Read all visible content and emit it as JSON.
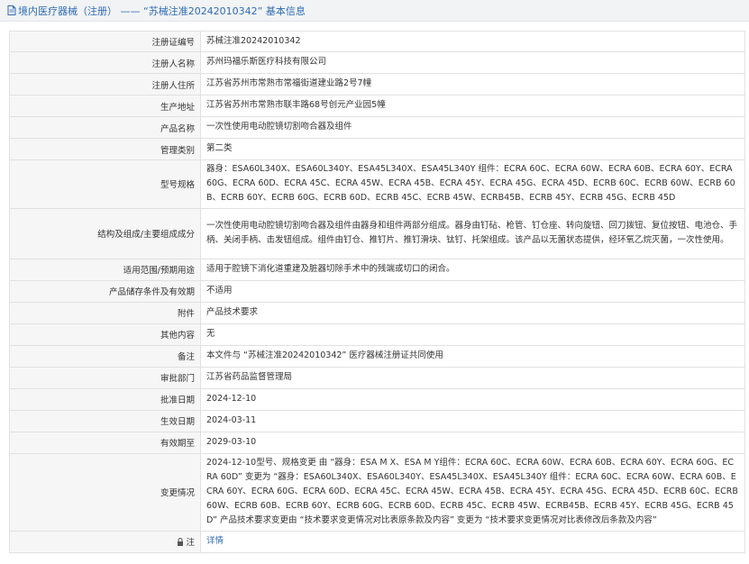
{
  "header": {
    "title": "境内医疗器械（注册） —— “苏械注准20242010342” 基本信息"
  },
  "rows": [
    {
      "label": "注册证编号",
      "value": "苏械注准20242010342"
    },
    {
      "label": "注册人名称",
      "value": "苏州玛福乐斯医疗科技有限公司"
    },
    {
      "label": "注册人住所",
      "value": "江苏省苏州市常熟市常福街道建业路2号7幢"
    },
    {
      "label": "生产地址",
      "value": "江苏省苏州市常熟市联丰路68号创元产业园5幢"
    },
    {
      "label": "产品名称",
      "value": "一次性使用电动腔镜切割吻合器及组件"
    },
    {
      "label": "管理类别",
      "value": "第二类"
    },
    {
      "label": "型号规格",
      "value": "器身：ESA60L340X、ESA60L340Y、ESA45L340X、ESA45L340Y 组件：ECRA 60C、ECRA 60W、ECRA 60B、ECRA 60Y、ECRA 60G、ECRA 60D、ECRA 45C、ECRA 45W、ECRA 45B、ECRA 45Y、ECRA 45G、ECRA 45D、ECRB 60C、ECRB 60W、ECRB 60B、ECRB 60Y、ECRB 60G、ECRB 60D、ECRB 45C、ECRB 45W、ECRB45B、ECRB 45Y、ECRB 45G、ECRB 45D"
    },
    {
      "label": "结构及组成/主要组成成分",
      "value": "一次性使用电动腔镜切割吻合器及组件由器身和组件两部分组成。器身由钉砧、枪管、钉仓座、转向旋钮、回刀拨钮、复位按钮、电池仓、手柄、关闭手柄、击发钮组成。组件由钉仓、推钉片、推钉滑块、钛钉、托架组成。该产品以无菌状态提供，经环氧乙烷灭菌，一次性使用。"
    },
    {
      "label": "适用范围/预期用途",
      "value": "适用于腔镜下消化道重建及脏器切除手术中的残端或切口的闭合。"
    },
    {
      "label": "产品储存条件及有效期",
      "value": "不适用"
    },
    {
      "label": "附件",
      "value": "产品技术要求"
    },
    {
      "label": "其他内容",
      "value": "无"
    },
    {
      "label": "备注",
      "value": "本文件与 “苏械注准20242010342” 医疗器械注册证共同使用"
    },
    {
      "label": "审批部门",
      "value": "江苏省药品监督管理局"
    },
    {
      "label": "批准日期",
      "value": "2024-12-10"
    },
    {
      "label": "生效日期",
      "value": "2024-03-11"
    },
    {
      "label": "有效期至",
      "value": "2029-03-10"
    },
    {
      "label": "变更情况",
      "value": "2024-12-10型号、规格变更 由 “器身：ESA M X、ESA M Y组件：ECRA 60C、ECRA 60W、ECRA 60B、ECRA 60Y、ECRA 60G、ECRA 60D” 变更为 “器身：ESA60L340X、ESA60L340Y、ESA45L340X、ESA45L340Y 组件：ECRA 60C、ECRA 60W、ECRA 60B、ECRA 60Y、ECRA 60G、ECRA 60D、ECRA 45C、ECRA 45W、ECRA 45B、ECRA 45Y、ECRA 45G、ECRA 45D、ECRB 60C、ECRB 60W、ECRB 60B、ECRB 60Y、ECRB 60G、ECRB 60D、ECRB 45C、ECRB 45W、ECRB45B、ECRB 45Y、ECRB 45G、ECRB 45D” 产品技术要求变更由 “技术要求变更情况对比表原条款及内容” 变更为 “技术要求变更情况对比表修改后条款及内容”"
    }
  ],
  "detail_row": {
    "label": "注",
    "link": "详情"
  },
  "colors": {
    "link": "#2f6bb3",
    "label_bg": "#f6f6f6",
    "border": "#e1e1e1",
    "header_bg": "#f1f3f5"
  }
}
